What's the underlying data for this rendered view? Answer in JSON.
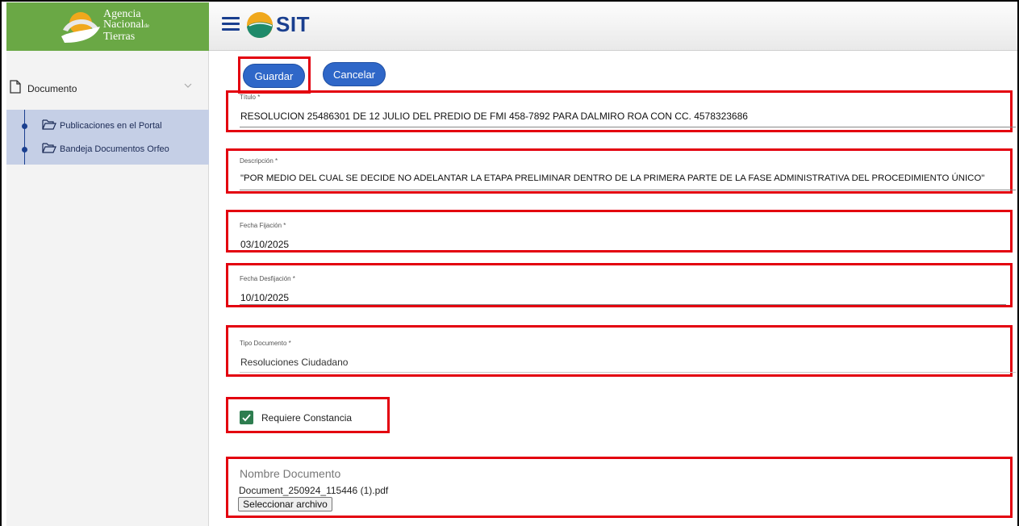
{
  "app": {
    "logo_text_lines": [
      "Agencia",
      "Nacional",
      "de",
      "Tierras"
    ],
    "brand": "SIT",
    "colors": {
      "primary": "#2f67c8",
      "accent_green": "#6aa845",
      "highlight_red": "#e3000f",
      "sidebar_active": "#c5cfe6"
    }
  },
  "header": {
    "menu_icon": "hamburger-menu-icon",
    "brand_label": "SIT"
  },
  "sidebar": {
    "section": {
      "label": "Documento",
      "icon": "document-icon",
      "expand_icon": "chevron-down-icon"
    },
    "items": [
      {
        "label": "Publicaciones en el Portal",
        "icon": "folder-open-icon"
      },
      {
        "label": "Bandeja Documentos Orfeo",
        "icon": "folder-open-icon"
      }
    ]
  },
  "toolbar": {
    "save_label": "Guardar",
    "cancel_label": "Cancelar"
  },
  "form": {
    "titulo": {
      "label": "Título *",
      "value": "RESOLUCION 25486301 DE 12 JULIO DEL PREDIO DE FMI 458-7892 PARA DALMIRO ROA CON CC. 4578323686"
    },
    "descripcion": {
      "label": "Descripción *",
      "value": "\"POR MEDIO DEL CUAL SE DECIDE NO ADELANTAR LA ETAPA PRELIMINAR DENTRO DE LA PRIMERA PARTE DE LA FASE ADMINISTRATIVA DEL PROCEDIMIENTO ÚNICO\""
    },
    "fecha_fijacion": {
      "label": "Fecha Fijación *",
      "value": "03/10/2025"
    },
    "fecha_desfijacion": {
      "label": "Fecha Desfijación *",
      "value": "10/10/2025"
    },
    "tipo_documento": {
      "label": "Tipo Documento *",
      "value": "Resoluciones Ciudadano"
    },
    "requiere_constancia": {
      "label": "Requiere Constancia",
      "checked": true
    },
    "nombre_documento": {
      "label": "Nombre Documento",
      "file_name": "Document_250924_115446 (1).pdf",
      "select_button": "Seleccionar archivo"
    }
  }
}
